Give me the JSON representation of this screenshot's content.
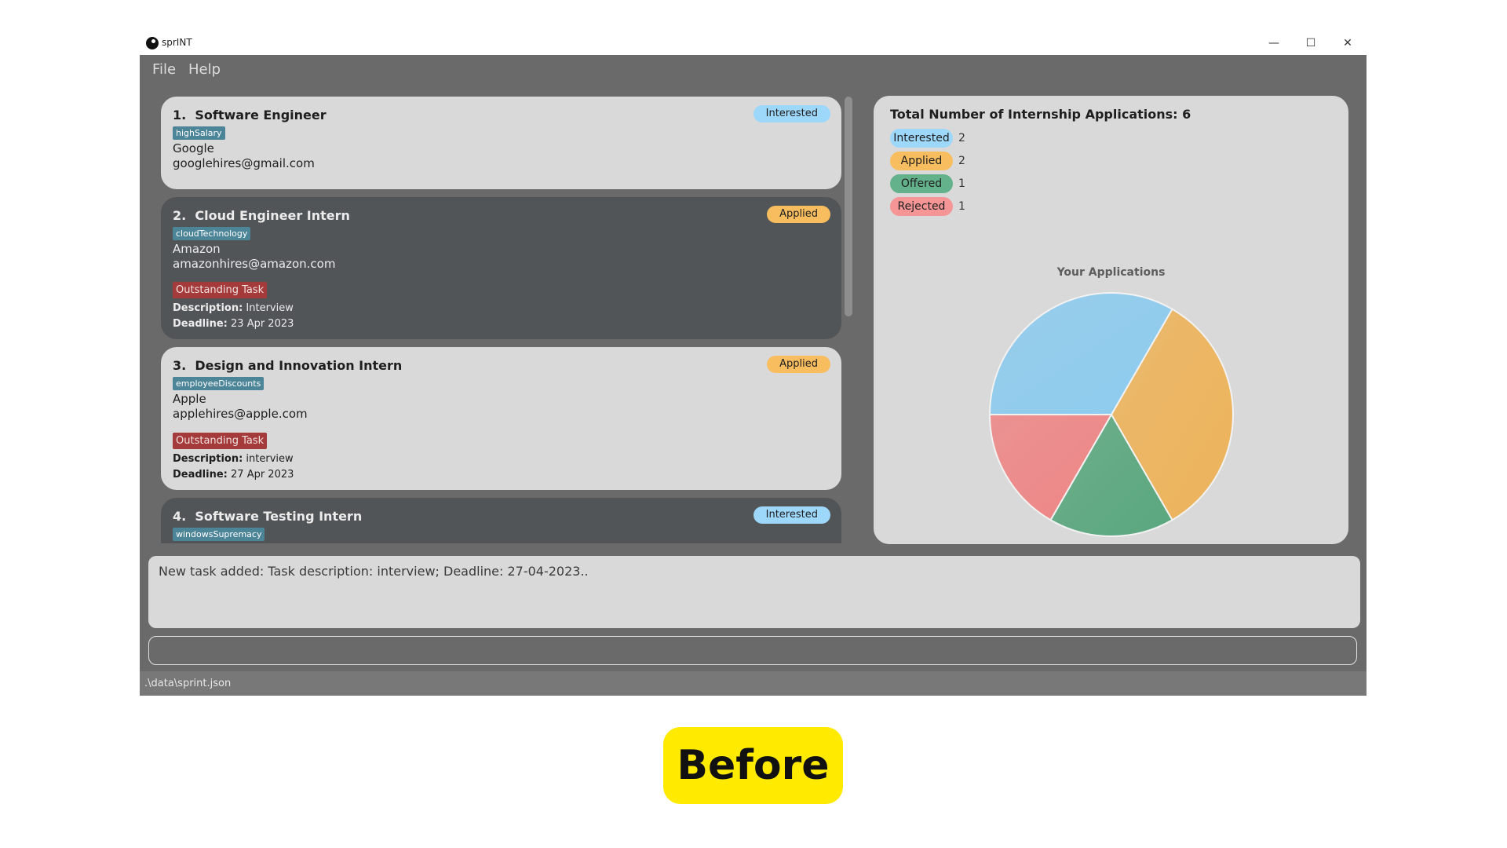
{
  "window": {
    "title": "sprINT",
    "controls": {
      "minimize": "—",
      "maximize": "☐",
      "close": "✕"
    }
  },
  "menu": {
    "items": [
      "File",
      "Help"
    ]
  },
  "applications": [
    {
      "index": "1.",
      "role": "Software Engineer",
      "tag": "highSalary",
      "company": "Google",
      "email": "googlehires@gmail.com",
      "status": "Interested",
      "theme": "light"
    },
    {
      "index": "2.",
      "role": "Cloud Engineer Intern",
      "tag": "cloudTechnology",
      "company": "Amazon",
      "email": "amazonhires@amazon.com",
      "status": "Applied",
      "theme": "dark",
      "task": {
        "label": "Outstanding Task",
        "description_label": "Description:",
        "description": "Interview",
        "deadline_label": "Deadline:",
        "deadline": "23 Apr 2023"
      }
    },
    {
      "index": "3.",
      "role": "Design and Innovation Intern",
      "tag": "employeeDiscounts",
      "company": "Apple",
      "email": "applehires@apple.com",
      "status": "Applied",
      "theme": "light",
      "task": {
        "label": "Outstanding Task",
        "description_label": "Description:",
        "description": "interview",
        "deadline_label": "Deadline:",
        "deadline": "27 Apr 2023"
      }
    },
    {
      "index": "4.",
      "role": "Software Testing Intern",
      "tag": "windowsSupremacy",
      "status": "Interested",
      "theme": "dark"
    }
  ],
  "stats": {
    "title": "Total Number of Internship Applications: 6",
    "rows": [
      {
        "label": "Interested",
        "count": "2"
      },
      {
        "label": "Applied",
        "count": "2"
      },
      {
        "label": "Offered",
        "count": "1"
      },
      {
        "label": "Rejected",
        "count": "1"
      }
    ]
  },
  "colors": {
    "interested": "#9dd7fa",
    "applied": "#f7bd5f",
    "offered": "#63b28b",
    "rejected": "#f59595",
    "tag": "#4c8498",
    "task": "#a43a3a"
  },
  "chart_data": {
    "type": "pie",
    "title": "Your Applications",
    "categories": [
      "Interested",
      "Applied",
      "Offered",
      "Rejected"
    ],
    "values": [
      2,
      2,
      1,
      1
    ],
    "colors": [
      "#8dcbee",
      "#edb35a",
      "#5aa77e",
      "#ee8585"
    ],
    "legend": "none"
  },
  "result": {
    "text": "New task added: Task description: interview; Deadline: 27-04-2023.."
  },
  "command": {
    "value": "",
    "placeholder": ""
  },
  "statusbar": {
    "path": ".\\data\\sprint.json"
  },
  "caption": {
    "label": "Before"
  }
}
